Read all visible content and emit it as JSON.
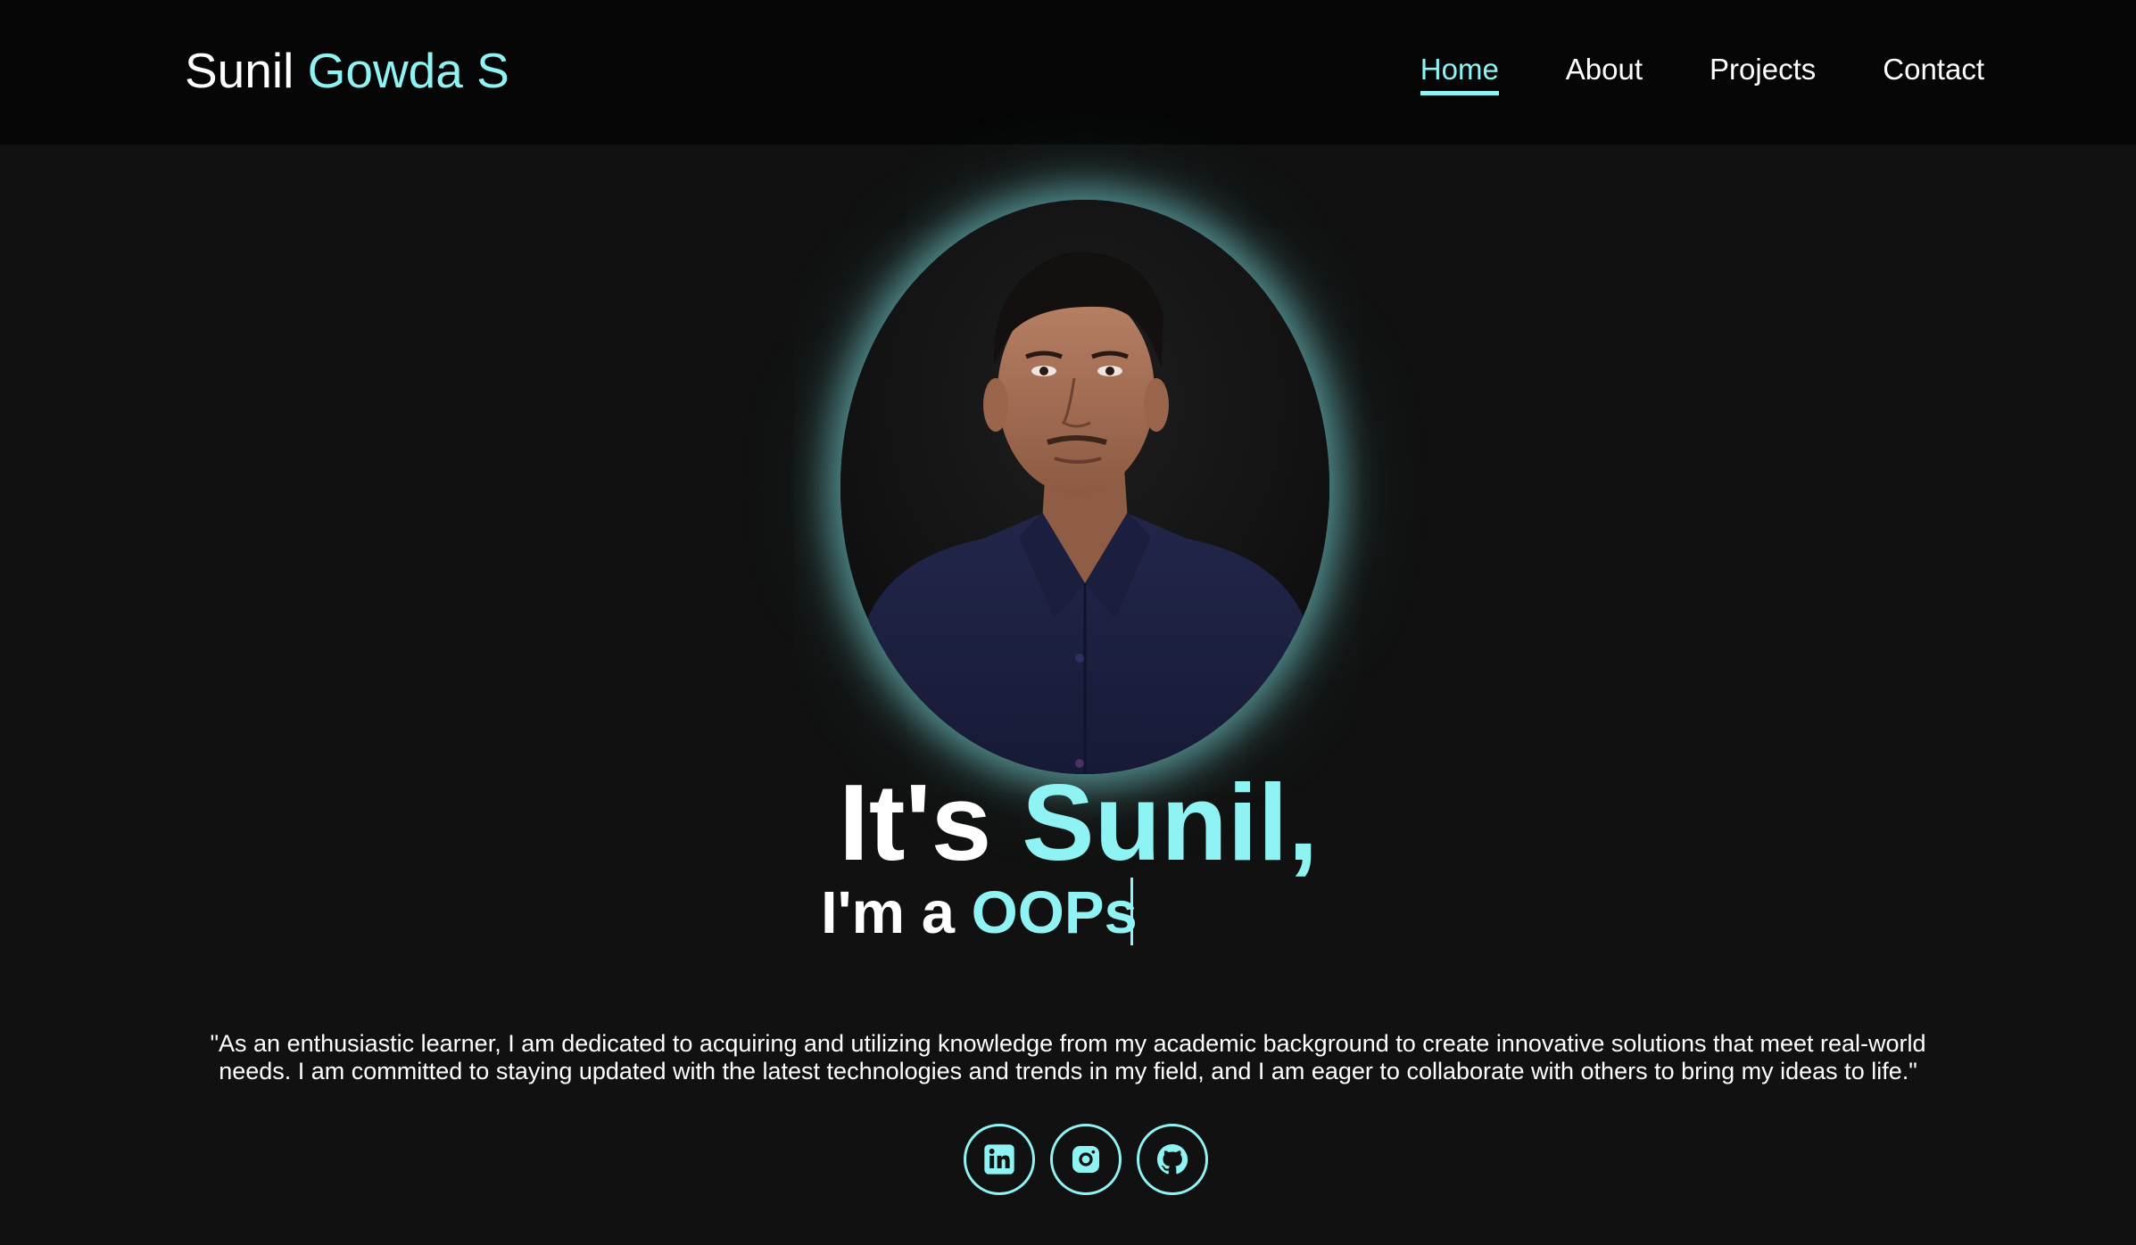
{
  "header": {
    "logo_first": "Sunil",
    "logo_accent": "Gowda S",
    "nav": [
      {
        "label": "Home",
        "active": true
      },
      {
        "label": "About",
        "active": false
      },
      {
        "label": "Projects",
        "active": false
      },
      {
        "label": "Contact",
        "active": false
      }
    ]
  },
  "hero": {
    "title_prefix": "It's",
    "title_name": "Sunil,",
    "subtitle_prefix": "I'm a",
    "subtitle_typed": "OOPs",
    "quote": "\"As an enthusiastic learner, I am dedicated to acquiring and utilizing knowledge from my academic background to create innovative solutions that meet real-world needs. I am committed to staying updated with the latest technologies and trends in my field, and I am eager to collaborate with others to bring my ideas to life.\""
  },
  "socials": [
    {
      "icon": "linkedin-icon"
    },
    {
      "icon": "instagram-icon"
    },
    {
      "icon": "github-icon"
    }
  ],
  "colors": {
    "accent": "#8ff3f3",
    "background": "#111111",
    "header_background": "#060606"
  }
}
